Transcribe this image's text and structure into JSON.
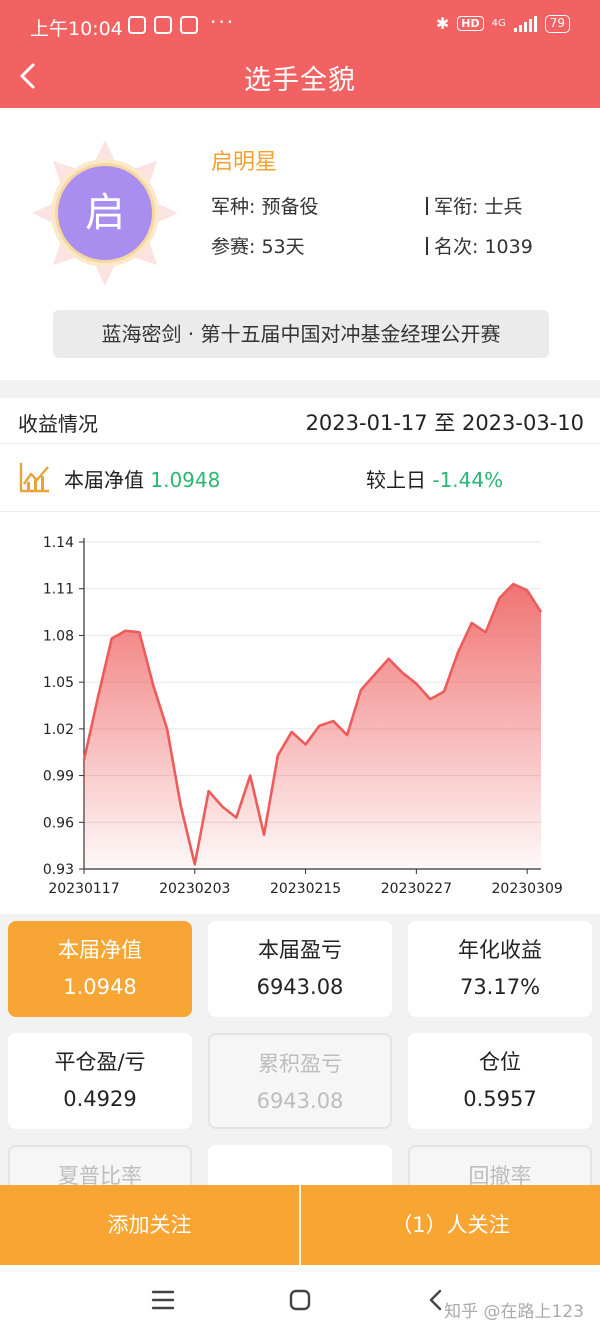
{
  "status_bar": {
    "time": "上午10:04",
    "notifications": [
      "app",
      "app",
      "app"
    ],
    "more": "···",
    "network": "4G",
    "hd": "HD",
    "battery": "79"
  },
  "header": {
    "title": "选手全貌"
  },
  "profile": {
    "avatar_char": "启",
    "name": "启明星",
    "branch_label": "军种: 预备役",
    "rank_label": "军衔: 士兵",
    "days_label": "参赛: 53天",
    "position_label": "名次: 1039",
    "contest": "蓝海密剑 · 第十五届中国对冲基金经理公开赛"
  },
  "income": {
    "title": "收益情况",
    "date_range": "2023-01-17 至 2023-03-10",
    "nav_label": "本届净值",
    "nav_value": "1.0948",
    "day_label": "较上日",
    "day_change": "-1.44%",
    "up_color": "#2bb673"
  },
  "chart_data": {
    "type": "area",
    "y_ticks": [
      "1.14",
      "1.11",
      "1.08",
      "1.05",
      "1.02",
      "0.99",
      "0.96",
      "0.93"
    ],
    "ylim": [
      0.93,
      1.14
    ],
    "x_ticks": [
      "20230117",
      "20230203",
      "20230215",
      "20230227",
      "20230309"
    ],
    "series": [
      {
        "color": "#ee5b5b",
        "values": [
          1.0,
          1.04,
          1.078,
          1.083,
          1.082,
          1.048,
          1.02,
          0.97,
          0.933,
          0.98,
          0.97,
          0.963,
          0.99,
          0.952,
          1.003,
          1.018,
          1.01,
          1.022,
          1.025,
          1.016,
          1.045,
          1.055,
          1.065,
          1.056,
          1.049,
          1.039,
          1.044,
          1.069,
          1.088,
          1.082,
          1.104,
          1.113,
          1.109,
          1.095
        ]
      }
    ],
    "grid": true
  },
  "stats": [
    {
      "title": "本届净值",
      "value": "1.0948"
    },
    {
      "title": "本届盈亏",
      "value": "6943.08"
    },
    {
      "title": "年化收益",
      "value": "73.17%"
    },
    {
      "title": "平仓盈/亏",
      "value": "0.4929"
    },
    {
      "title": "累积盈亏",
      "value": "6943.08"
    },
    {
      "title": "仓位",
      "value": "0.5957"
    },
    {
      "title": "夏普比率",
      "value": ""
    },
    {
      "title": "",
      "value": ""
    },
    {
      "title": "回撤率",
      "value": ""
    }
  ],
  "bottom_bar": {
    "follow_label": "添加关注",
    "followers_label": "（1）人关注"
  },
  "watermark": "知乎 @在路上123"
}
